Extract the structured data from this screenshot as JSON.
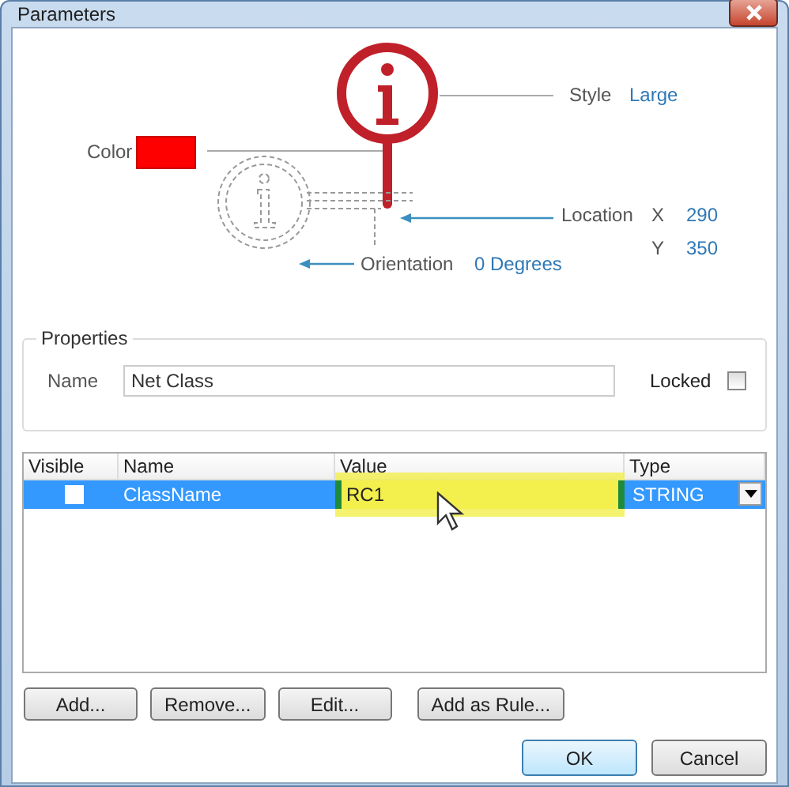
{
  "window": {
    "title": "Parameters"
  },
  "diagram": {
    "color_label": "Color",
    "color": "#ff0000",
    "style_label": "Style",
    "style_value": "Large",
    "location_label": "Location",
    "x_label": "X",
    "x_value": "290",
    "y_label": "Y",
    "y_value": "350",
    "orientation_label": "Orientation",
    "orientation_value": "0 Degrees"
  },
  "properties": {
    "title": "Properties",
    "name_label": "Name",
    "name_value": "Net Class",
    "locked_label": "Locked",
    "locked": false
  },
  "table": {
    "columns": [
      "Visible",
      "Name",
      "Value",
      "Type"
    ],
    "rows": [
      {
        "visible": false,
        "name": "ClassName",
        "value": "RC1",
        "type": "STRING",
        "selected": true
      }
    ]
  },
  "buttons": [
    "Add...",
    "Remove...",
    "Edit...",
    "Add as Rule..."
  ],
  "footer_buttons": [
    {
      "label": "OK",
      "default": true
    },
    {
      "label": "Cancel",
      "default": false
    }
  ]
}
